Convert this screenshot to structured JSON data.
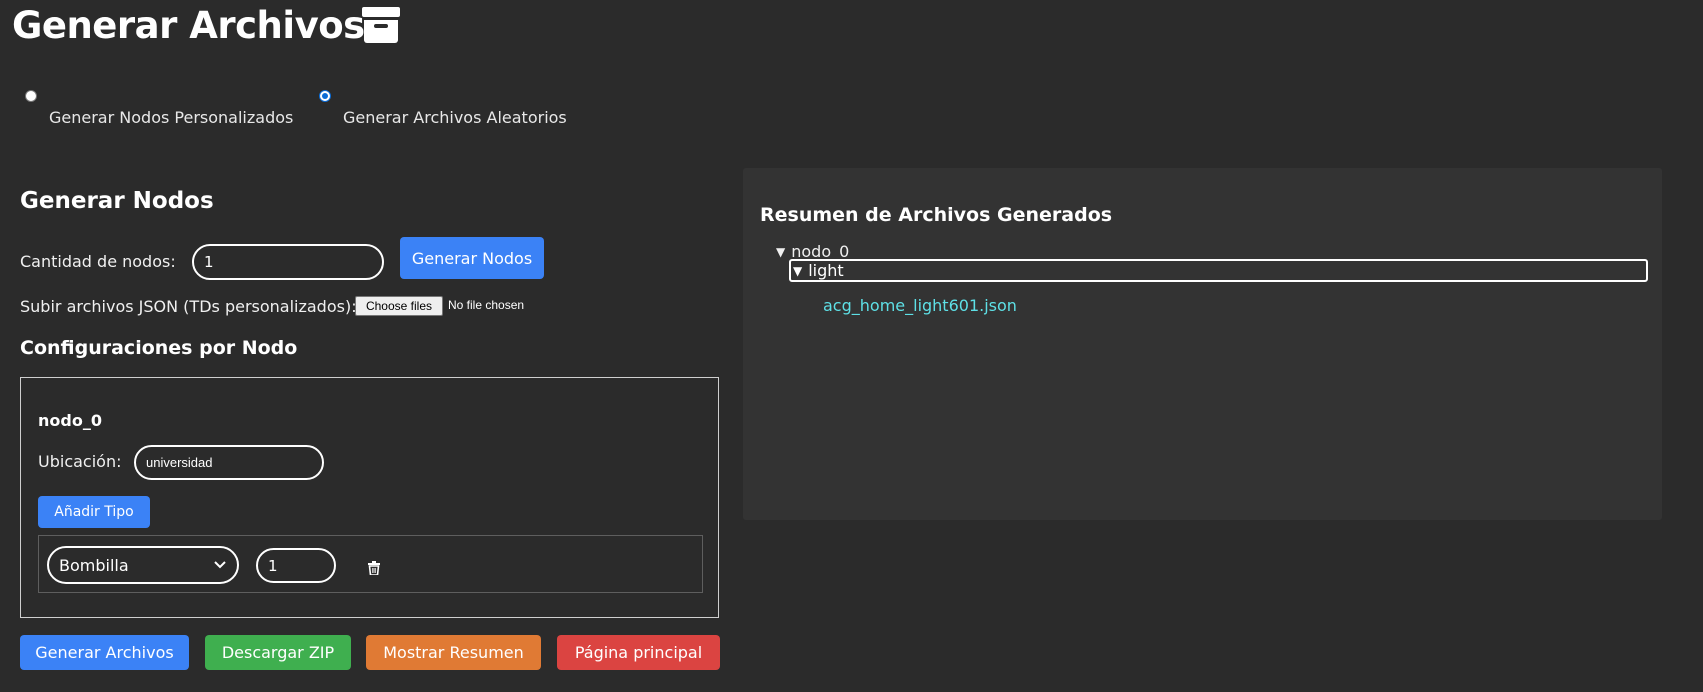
{
  "header": {
    "title": "Generar Archivos",
    "icon": "archive-icon"
  },
  "mode": {
    "options": [
      {
        "label": "Generar Nodos Personalizados",
        "checked": false
      },
      {
        "label": "Generar Archivos Aleatorios",
        "checked": true
      }
    ]
  },
  "generate_nodes": {
    "heading": "Generar Nodos",
    "count_label": "Cantidad de nodos:",
    "count_value": "1",
    "generate_button": "Generar Nodos",
    "upload_label": "Subir archivos JSON (TDs personalizados):",
    "choose_files": "Choose files",
    "no_file": "No file chosen"
  },
  "node_config": {
    "heading": "Configuraciones por Nodo",
    "nodes": [
      {
        "name": "nodo_0",
        "location_label": "Ubicación:",
        "location_value": "universidad",
        "add_type_button": "Añadir Tipo",
        "types": [
          {
            "type": "Bombilla",
            "quantity": "1"
          }
        ]
      }
    ]
  },
  "actions": {
    "generate": "Generar Archivos",
    "download": "Descargar ZIP",
    "summary": "Mostrar Resumen",
    "home": "Página principal"
  },
  "summary": {
    "heading": "Resumen de Archivos Generados",
    "tree": {
      "node": "nodo_0",
      "folder": "light",
      "files": [
        "acg_home_light601.json"
      ]
    }
  },
  "colors": {
    "background": "#2b2b2b",
    "panel": "#333333",
    "blue": "#3b82f6",
    "green": "#3faf4f",
    "orange": "#e07a34",
    "red": "#db4441",
    "link": "#5ee0e6"
  }
}
